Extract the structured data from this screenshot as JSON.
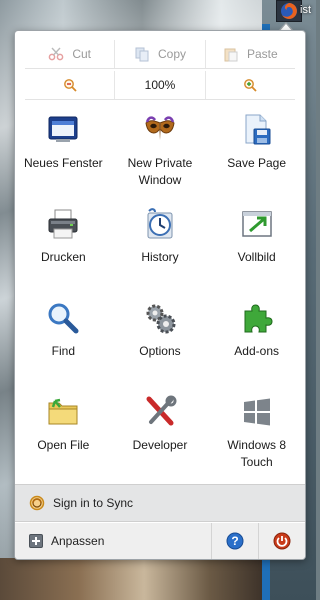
{
  "browser_button": {
    "icon": "firefox-icon"
  },
  "side_text": "ist",
  "side_text_2": "i",
  "edit_row": {
    "cut": "Cut",
    "copy": "Copy",
    "paste": "Paste"
  },
  "zoom_row": {
    "zoom_out_icon": "zoom-out-icon",
    "zoom_level": "100%",
    "zoom_in_icon": "zoom-in-icon"
  },
  "tiles": [
    {
      "label": "Neues Fenster",
      "icon": "new-window-icon"
    },
    {
      "label": "New Private Window",
      "icon": "private-mask-icon"
    },
    {
      "label": "Save Page",
      "icon": "save-page-icon"
    },
    {
      "label": "Drucken",
      "icon": "printer-icon"
    },
    {
      "label": "History",
      "icon": "history-clock-icon"
    },
    {
      "label": "Vollbild",
      "icon": "fullscreen-icon"
    },
    {
      "label": "Find",
      "icon": "magnifier-icon"
    },
    {
      "label": "Options",
      "icon": "gears-icon"
    },
    {
      "label": "Add-ons",
      "icon": "puzzle-icon"
    },
    {
      "label": "Open File",
      "icon": "folder-icon"
    },
    {
      "label": "Developer",
      "icon": "wrench-icon"
    },
    {
      "label": "Windows 8 Touch",
      "icon": "windows-logo-icon"
    }
  ],
  "sync": {
    "label": "Sign in to Sync",
    "icon": "sync-icon"
  },
  "footer": {
    "customize_label": "Anpassen",
    "help_icon": "help-icon",
    "quit_icon": "power-icon"
  },
  "colors": {
    "help_blue": "#2a6fc9",
    "quit_red": "#c93b1a",
    "puzzle_green": "#3fa83a"
  }
}
